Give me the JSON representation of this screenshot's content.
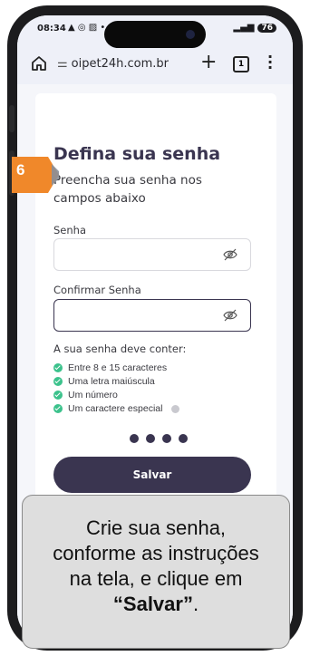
{
  "status_bar": {
    "time": "08:34",
    "notif_icons": "▲ ◎ ▨ •",
    "battery": "76"
  },
  "browser": {
    "url": "oipet24h.com.br",
    "tab_count": "1"
  },
  "form": {
    "title": "Defina sua senha",
    "subtitle": "Preencha sua senha nos campos abaixo",
    "password_label": "Senha",
    "confirm_label": "Confirmar Senha",
    "rules_title": "A sua senha deve conter:",
    "rules": [
      "Entre 8 e 15 caracteres",
      "Uma letra maiúscula",
      "Um número",
      "Um caractere especial"
    ],
    "submit_label": "Salvar"
  },
  "tutorial": {
    "step_number": "6",
    "caption_line1": "Crie sua senha,",
    "caption_line2": "conforme as instruções",
    "caption_line3": "na tela, e clique em",
    "caption_bold": "“Salvar”",
    "caption_end": "."
  },
  "colors": {
    "brand": "#3a3550",
    "check": "#3cc28c",
    "step_badge": "#f0882a"
  }
}
